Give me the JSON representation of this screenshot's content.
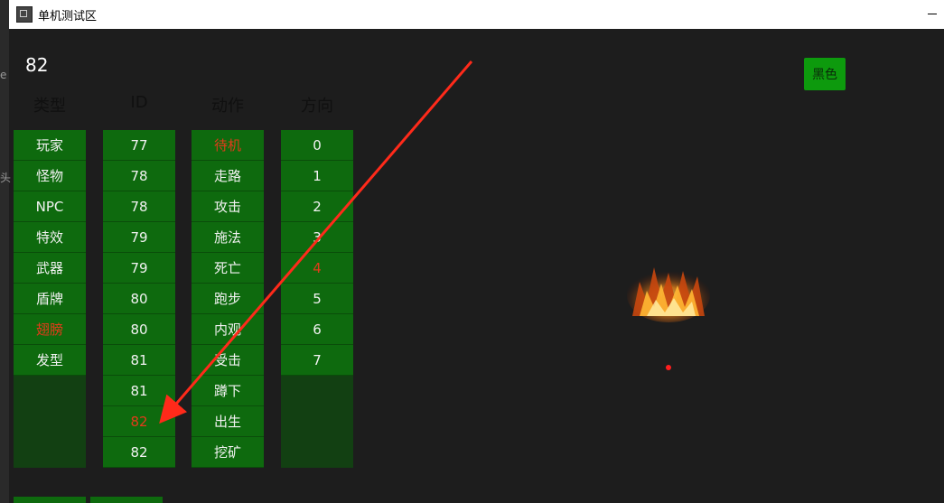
{
  "window": {
    "title": "单机测试区"
  },
  "left_strip": {
    "fragment_1": "e",
    "fragment_2": "头"
  },
  "current_id": "82",
  "columns": {
    "type": {
      "header": "类型",
      "items": [
        "玩家",
        "怪物",
        "NPC",
        "特效",
        "武器",
        "盾牌",
        "翅膀",
        "发型"
      ],
      "selected_index": 6
    },
    "id": {
      "header": "ID",
      "items": [
        "77",
        "78",
        "78",
        "79",
        "79",
        "80",
        "80",
        "81",
        "81",
        "82",
        "82"
      ],
      "selected_index": 9
    },
    "action": {
      "header": "动作",
      "items": [
        "待机",
        "走路",
        "攻击",
        "施法",
        "死亡",
        "跑步",
        "内观",
        "受击",
        "蹲下",
        "出生",
        "挖矿"
      ],
      "selected_index": 0
    },
    "direction": {
      "header": "方向",
      "items": [
        "0",
        "1",
        "2",
        "3",
        "4",
        "5",
        "6",
        "7"
      ],
      "selected_index": 4
    }
  },
  "color_button": {
    "label": "黑色"
  },
  "colors": {
    "cell": "#0e6a0e",
    "selected_text": "#e23b1a",
    "annotation_arrow": "#ff2a1a",
    "background": "#1d1d1d"
  },
  "icons": {
    "app": "app-icon",
    "minimize": "minimize-icon",
    "effect": "fire-effect-sprite",
    "anchor": "anchor-dot"
  }
}
